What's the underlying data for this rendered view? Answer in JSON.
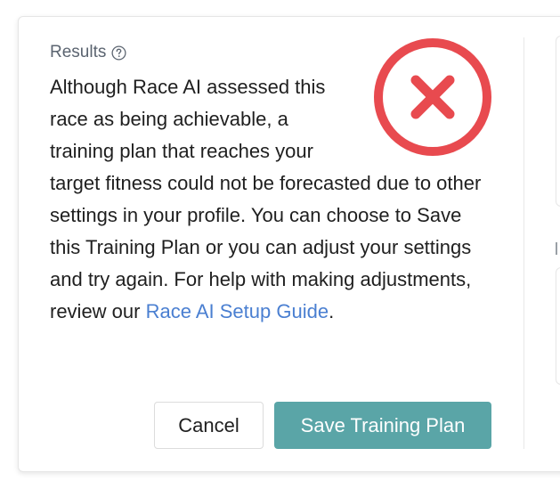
{
  "dialog": {
    "section_label": "Results",
    "message_before_link": "Although Race AI assessed this race as being achievable, a training plan that reaches your target fitness could not be forecasted due to other settings in your profile. You can choose to Save this Training Plan or you can adjust your settings and try again. For help with making adjustments, review our ",
    "link_text": "Race AI Setup Guide",
    "message_after_link": ".",
    "status_icon": "error-x-circle-icon",
    "buttons": {
      "cancel_label": "Cancel",
      "save_label": "Save Training Plan"
    }
  },
  "colors": {
    "error_red": "#e84a4f",
    "primary_teal": "#5aa5a7",
    "link_blue": "#4a7fd1",
    "label_gray": "#5b6470",
    "text_dark": "#1f1f1f"
  }
}
